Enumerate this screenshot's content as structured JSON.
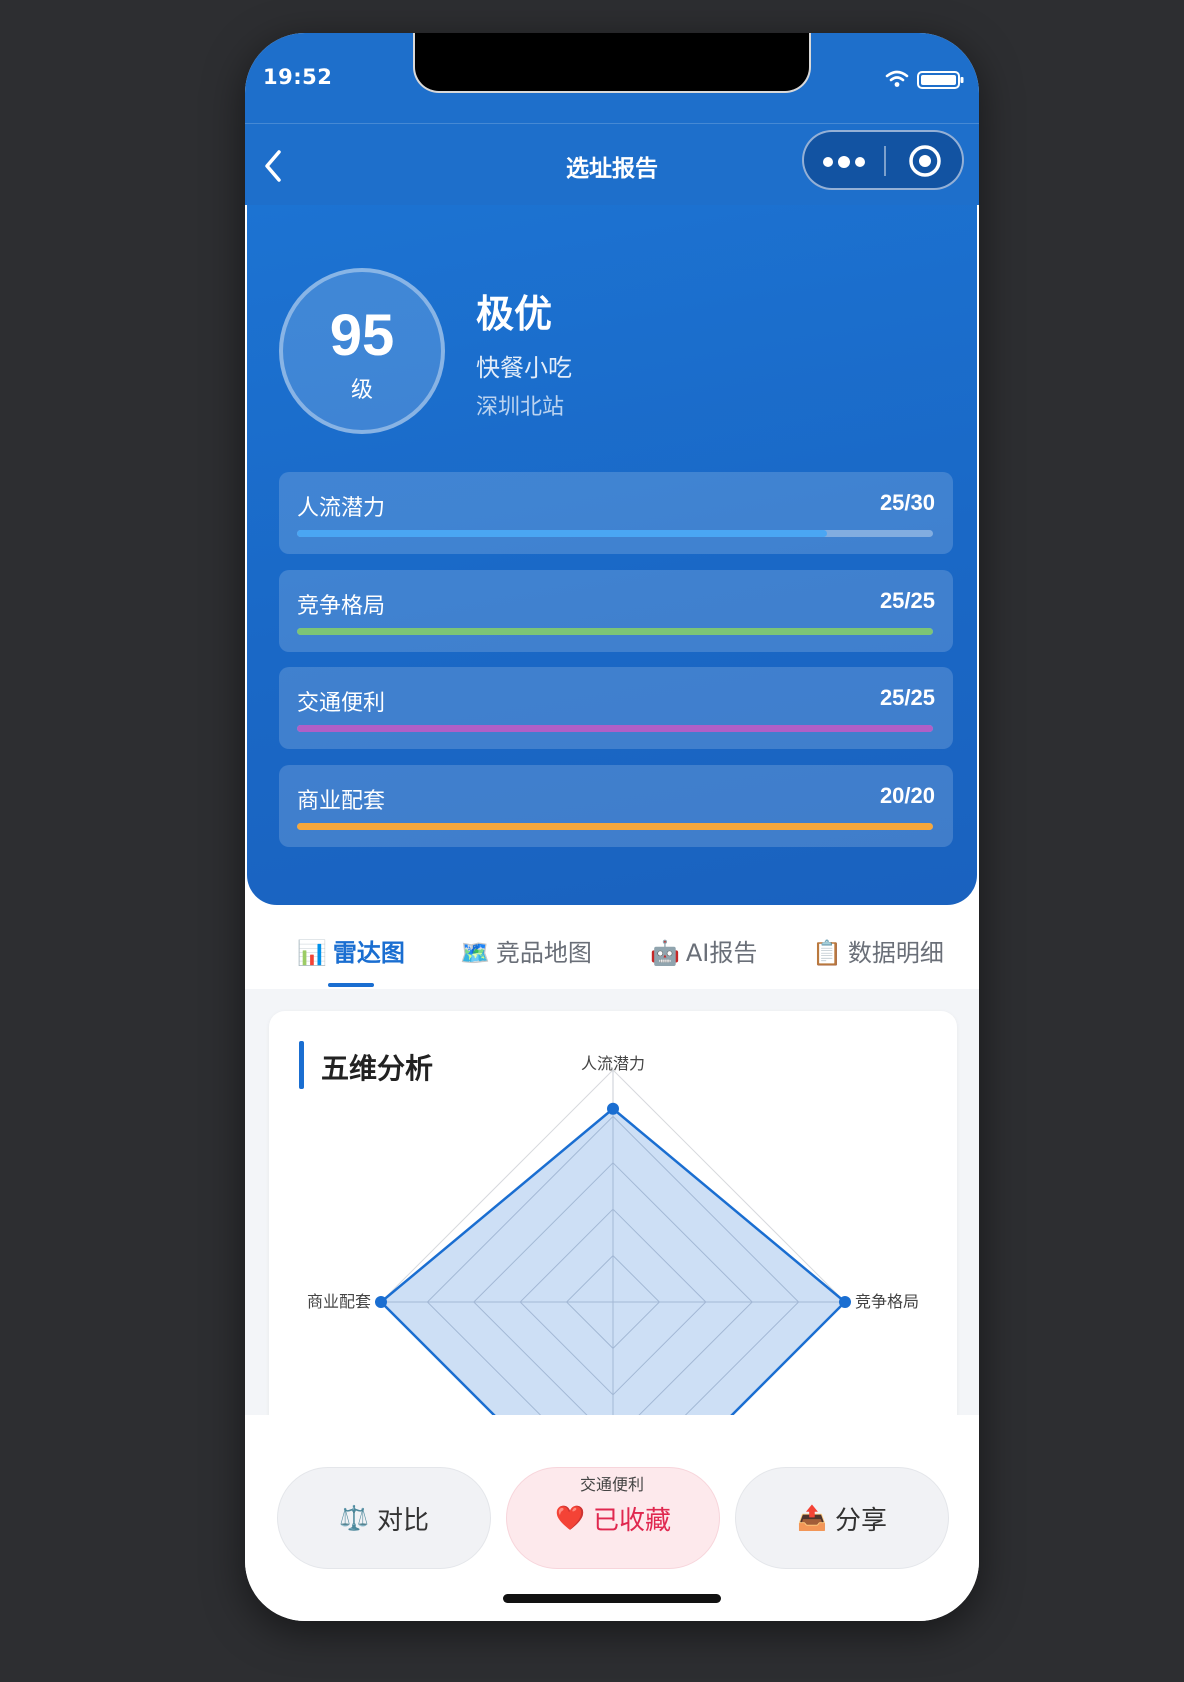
{
  "status": {
    "time": "19:52"
  },
  "nav": {
    "title": "选址报告"
  },
  "summary": {
    "score": "95",
    "score_unit": "级",
    "grade": "极优",
    "category": "快餐小吃",
    "location": "深圳北站"
  },
  "metrics": [
    {
      "label": "人流潜力",
      "score": "25/30",
      "fraction": 0.833,
      "color": "#4aa6f3"
    },
    {
      "label": "竞争格局",
      "score": "25/25",
      "fraction": 1.0,
      "color": "#7cc576"
    },
    {
      "label": "交通便利",
      "score": "25/25",
      "fraction": 1.0,
      "color": "#b05fc6"
    },
    {
      "label": "商业配套",
      "score": "20/20",
      "fraction": 1.0,
      "color": "#f5a73c"
    }
  ],
  "tabs": [
    {
      "icon": "📊",
      "label": "雷达图",
      "active": true
    },
    {
      "icon": "🗺️",
      "label": "竞品地图",
      "active": false
    },
    {
      "icon": "🤖",
      "label": "AI报告",
      "active": false
    },
    {
      "icon": "📋",
      "label": "数据明细",
      "active": false
    }
  ],
  "analysis": {
    "title": "五维分析"
  },
  "chart_data": {
    "type": "radar",
    "axes": [
      "人流潜力",
      "竞争格局",
      "交通便利",
      "商业配套"
    ],
    "values": [
      0.833,
      1.0,
      1.0,
      1.0
    ],
    "max": 1.0,
    "rings": 5,
    "series_color": "#1a6ed1"
  },
  "actions": {
    "compare": {
      "icon": "⚖️",
      "label": "对比"
    },
    "favorite": {
      "icon": "❤️",
      "label": "已收藏"
    },
    "share": {
      "icon": "📤",
      "label": "分享"
    }
  },
  "colors": {
    "primary": "#1e6fcb",
    "accent": "#1a6ed1",
    "favorite": "#e0284f"
  }
}
